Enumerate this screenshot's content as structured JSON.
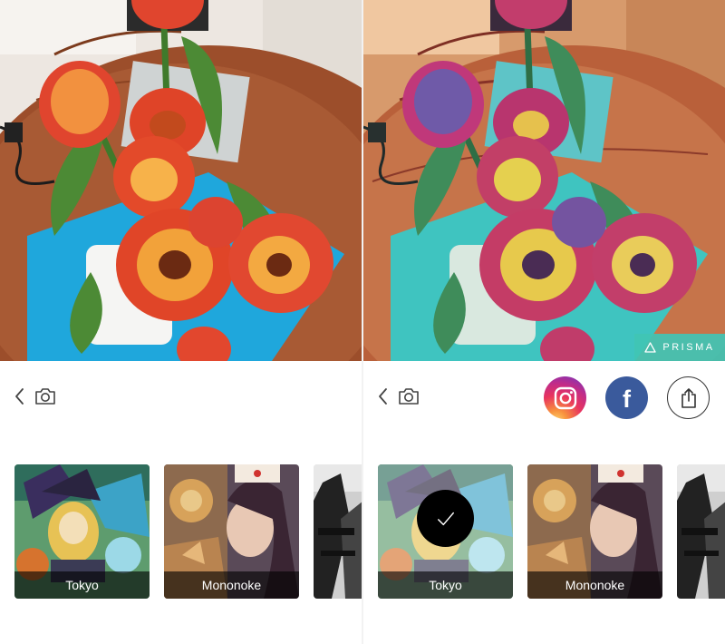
{
  "original_view": {
    "photo": {
      "subject": "tulips-photo"
    },
    "toolbar": {
      "back_icon": "chevron-left-icon",
      "camera_icon": "camera-icon"
    },
    "filters": [
      {
        "label": "Tokyo",
        "selected": false
      },
      {
        "label": "Mononoke",
        "selected": false
      }
    ]
  },
  "styled_view": {
    "photo": {
      "subject": "tulips-stylized"
    },
    "watermark": {
      "text": "PRISMA"
    },
    "toolbar": {
      "back_icon": "chevron-left-icon",
      "camera_icon": "camera-icon",
      "share_buttons": [
        {
          "name": "instagram",
          "icon": "instagram-icon"
        },
        {
          "name": "facebook",
          "icon": "facebook-icon",
          "glyph": "f"
        },
        {
          "name": "share",
          "icon": "share-icon"
        }
      ]
    },
    "filters": [
      {
        "label": "Tokyo",
        "selected": true
      },
      {
        "label": "Mononoke",
        "selected": false
      }
    ]
  },
  "colors": {
    "instagram": "#c22c88",
    "facebook": "#3a5a9c",
    "watermark": "#40c4b4",
    "label_bg": "#000000"
  }
}
